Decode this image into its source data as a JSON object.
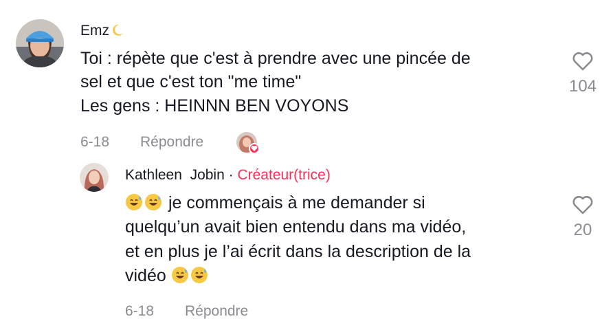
{
  "comment": {
    "username": "Emz",
    "username_emoji": "crescent-moon",
    "lines": [
      "Toi : répète que c'est à prendre avec une pincée de",
      "sel et que c'est ton \"me time\"",
      "Les gens : HEINNN BEN VOYONS"
    ],
    "date": "6-18",
    "reply_label": "Répondre",
    "like_count": "104",
    "avatar_icon": "user-avatar-blue-cap",
    "creator_liked_icon": "creator-liked-heart-icon"
  },
  "reply": {
    "username": "Kathleen  Jobin",
    "separator": "·",
    "creator_label": "Créateur(trice)",
    "lines": [
      "je commençais à me demander si",
      "quelqu’un avait bien entendu dans ma vidéo,",
      "et en plus je l’ai écrit dans la description de la",
      "vidéo"
    ],
    "emojis": [
      "grinning-sweat",
      "grinning-sweat"
    ],
    "date": "6-18",
    "reply_label": "Répondre",
    "like_count": "20",
    "avatar_icon": "creator-avatar"
  },
  "colors": {
    "accent": "#fe2c55",
    "text": "#161823",
    "muted": "#8a8b91"
  }
}
